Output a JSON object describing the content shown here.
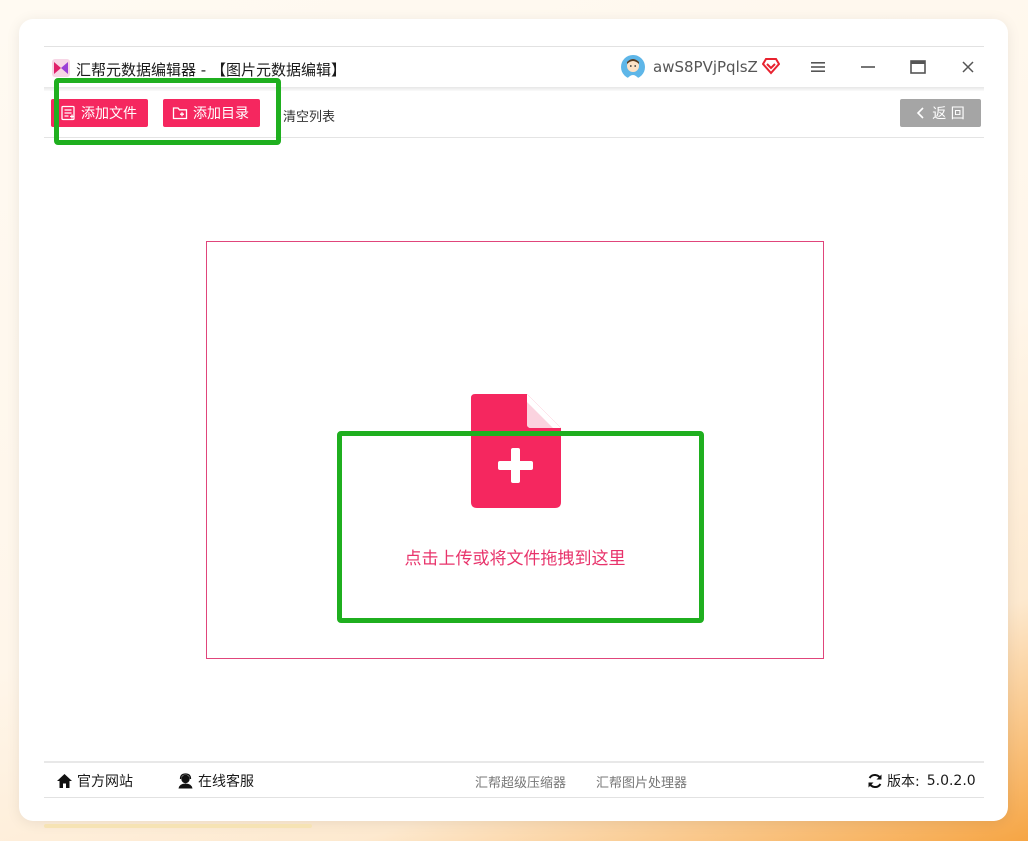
{
  "window": {
    "app_title": "汇帮元数据编辑器 - 【图片元数据编辑】",
    "username": "awS8PVjPqlsZ",
    "controls": [
      "menu-icon",
      "minimize-icon",
      "maximize-icon",
      "close-icon"
    ]
  },
  "toolbar": {
    "add_file_label": "添加文件",
    "add_dir_label": "添加目录",
    "clear_list_label": "清空列表",
    "back_label": "返 回"
  },
  "dropzone": {
    "text": "点击上传或将文件拖拽到这里",
    "icon": "add-file-icon"
  },
  "footer": {
    "website_label": "官方网站",
    "support_label": "在线客服",
    "links": [
      "汇帮超级压缩器",
      "汇帮图片处理器"
    ],
    "version_label": "版本:",
    "version_value": "5.0.2.0"
  },
  "colors": {
    "accent": "#f5275f",
    "highlight": "#1faf1f",
    "back_button": "#a5a5a5"
  }
}
